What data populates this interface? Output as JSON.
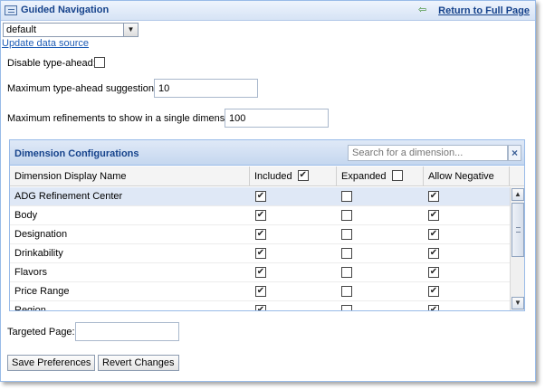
{
  "header": {
    "title": "Guided Navigation",
    "return_link": "Return to Full Page"
  },
  "data_source": {
    "selected": "default",
    "update_link": "Update data source"
  },
  "settings": {
    "disable_typeahead_label": "Disable type-ahead:",
    "disable_typeahead_checked": false,
    "max_typeahead_label": "Maximum type-ahead suggestions:",
    "max_typeahead_value": "10",
    "max_refinements_label": "Maximum refinements to show in a single dimension:",
    "max_refinements_value": "100"
  },
  "dimensions_panel": {
    "title": "Dimension Configurations",
    "search_placeholder": "Search for a dimension...",
    "columns": {
      "name": "Dimension Display Name",
      "included": "Included",
      "expanded": "Expanded",
      "allow_negative": "Allow Negative"
    },
    "header_checks": {
      "included": true,
      "expanded": false,
      "allow_negative": true
    },
    "rows": [
      {
        "name": "ADG Refinement Center",
        "included": true,
        "expanded": false,
        "allow_negative": true
      },
      {
        "name": "Body",
        "included": true,
        "expanded": false,
        "allow_negative": true
      },
      {
        "name": "Designation",
        "included": true,
        "expanded": false,
        "allow_negative": true
      },
      {
        "name": "Drinkability",
        "included": true,
        "expanded": false,
        "allow_negative": true
      },
      {
        "name": "Flavors",
        "included": true,
        "expanded": false,
        "allow_negative": true
      },
      {
        "name": "Price Range",
        "included": true,
        "expanded": false,
        "allow_negative": true
      },
      {
        "name": "Region",
        "included": true,
        "expanded": false,
        "allow_negative": true
      }
    ]
  },
  "targeted_page": {
    "label": "Targeted Page:",
    "value": ""
  },
  "actions": {
    "save": "Save Preferences",
    "revert": "Revert Changes"
  },
  "colors": {
    "header_text": "#15428b",
    "link": "#1c5bb5",
    "border": "#99bbe8",
    "selected_row": "#dfe8f6"
  }
}
